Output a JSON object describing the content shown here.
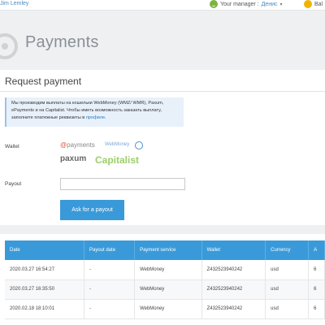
{
  "topbar": {
    "user": "Jim Lemley",
    "manager_label": "Your manager :",
    "manager_name": "Денис",
    "balance_label": "Bal"
  },
  "header": {
    "title": "Payments"
  },
  "request": {
    "title": "Request payment",
    "notice_text": "Мы производим выплаты на кошельки WebMoney (WMZ/ WMR), Paxum, ePayments и на Capitalist. Чтобы иметь возможность заказать выплату, заполните платежные реквизиты в",
    "notice_link": "профиле",
    "notice_end": ".",
    "wallet_label": "Wallet",
    "wallets": {
      "epayments_prefix": "@",
      "epayments": "payments",
      "webmoney": "WebMoney",
      "paxum": "paxum",
      "capitalist": "Capitalist"
    },
    "payout_label": "Payout",
    "payout_value": "",
    "ask_button": "Ask for a payout"
  },
  "table": {
    "headers": [
      "Date",
      "Payout date",
      "Payment service",
      "Wallet",
      "Currency",
      "A"
    ],
    "rows": [
      [
        "2020.03.27 16:54:27",
        "-",
        "WebMoney",
        "Z432523940242",
        "usd",
        "6"
      ],
      [
        "2020.03.27 16:35:50",
        "-",
        "WebMoney",
        "Z432523940242",
        "usd",
        "6"
      ],
      [
        "2020.02.18 18:10:01",
        "-",
        "WebMoney",
        "Z432523940242",
        "usd",
        "6"
      ]
    ]
  },
  "colors": {
    "accent": "#3a9ad9",
    "notice_bg": "#e8f1fa",
    "capitalist": "#9ccf6a",
    "epayments_at": "#e0513b"
  }
}
